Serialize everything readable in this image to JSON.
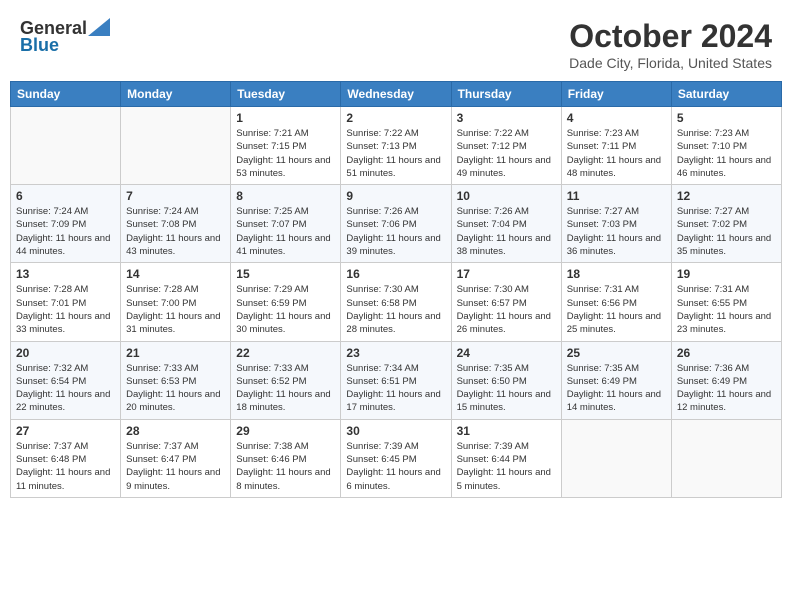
{
  "header": {
    "logo_general": "General",
    "logo_blue": "Blue",
    "month_title": "October 2024",
    "location": "Dade City, Florida, United States"
  },
  "days_of_week": [
    "Sunday",
    "Monday",
    "Tuesday",
    "Wednesday",
    "Thursday",
    "Friday",
    "Saturday"
  ],
  "weeks": [
    [
      {
        "day": "",
        "detail": ""
      },
      {
        "day": "",
        "detail": ""
      },
      {
        "day": "1",
        "detail": "Sunrise: 7:21 AM\nSunset: 7:15 PM\nDaylight: 11 hours and 53 minutes."
      },
      {
        "day": "2",
        "detail": "Sunrise: 7:22 AM\nSunset: 7:13 PM\nDaylight: 11 hours and 51 minutes."
      },
      {
        "day": "3",
        "detail": "Sunrise: 7:22 AM\nSunset: 7:12 PM\nDaylight: 11 hours and 49 minutes."
      },
      {
        "day": "4",
        "detail": "Sunrise: 7:23 AM\nSunset: 7:11 PM\nDaylight: 11 hours and 48 minutes."
      },
      {
        "day": "5",
        "detail": "Sunrise: 7:23 AM\nSunset: 7:10 PM\nDaylight: 11 hours and 46 minutes."
      }
    ],
    [
      {
        "day": "6",
        "detail": "Sunrise: 7:24 AM\nSunset: 7:09 PM\nDaylight: 11 hours and 44 minutes."
      },
      {
        "day": "7",
        "detail": "Sunrise: 7:24 AM\nSunset: 7:08 PM\nDaylight: 11 hours and 43 minutes."
      },
      {
        "day": "8",
        "detail": "Sunrise: 7:25 AM\nSunset: 7:07 PM\nDaylight: 11 hours and 41 minutes."
      },
      {
        "day": "9",
        "detail": "Sunrise: 7:26 AM\nSunset: 7:06 PM\nDaylight: 11 hours and 39 minutes."
      },
      {
        "day": "10",
        "detail": "Sunrise: 7:26 AM\nSunset: 7:04 PM\nDaylight: 11 hours and 38 minutes."
      },
      {
        "day": "11",
        "detail": "Sunrise: 7:27 AM\nSunset: 7:03 PM\nDaylight: 11 hours and 36 minutes."
      },
      {
        "day": "12",
        "detail": "Sunrise: 7:27 AM\nSunset: 7:02 PM\nDaylight: 11 hours and 35 minutes."
      }
    ],
    [
      {
        "day": "13",
        "detail": "Sunrise: 7:28 AM\nSunset: 7:01 PM\nDaylight: 11 hours and 33 minutes."
      },
      {
        "day": "14",
        "detail": "Sunrise: 7:28 AM\nSunset: 7:00 PM\nDaylight: 11 hours and 31 minutes."
      },
      {
        "day": "15",
        "detail": "Sunrise: 7:29 AM\nSunset: 6:59 PM\nDaylight: 11 hours and 30 minutes."
      },
      {
        "day": "16",
        "detail": "Sunrise: 7:30 AM\nSunset: 6:58 PM\nDaylight: 11 hours and 28 minutes."
      },
      {
        "day": "17",
        "detail": "Sunrise: 7:30 AM\nSunset: 6:57 PM\nDaylight: 11 hours and 26 minutes."
      },
      {
        "day": "18",
        "detail": "Sunrise: 7:31 AM\nSunset: 6:56 PM\nDaylight: 11 hours and 25 minutes."
      },
      {
        "day": "19",
        "detail": "Sunrise: 7:31 AM\nSunset: 6:55 PM\nDaylight: 11 hours and 23 minutes."
      }
    ],
    [
      {
        "day": "20",
        "detail": "Sunrise: 7:32 AM\nSunset: 6:54 PM\nDaylight: 11 hours and 22 minutes."
      },
      {
        "day": "21",
        "detail": "Sunrise: 7:33 AM\nSunset: 6:53 PM\nDaylight: 11 hours and 20 minutes."
      },
      {
        "day": "22",
        "detail": "Sunrise: 7:33 AM\nSunset: 6:52 PM\nDaylight: 11 hours and 18 minutes."
      },
      {
        "day": "23",
        "detail": "Sunrise: 7:34 AM\nSunset: 6:51 PM\nDaylight: 11 hours and 17 minutes."
      },
      {
        "day": "24",
        "detail": "Sunrise: 7:35 AM\nSunset: 6:50 PM\nDaylight: 11 hours and 15 minutes."
      },
      {
        "day": "25",
        "detail": "Sunrise: 7:35 AM\nSunset: 6:49 PM\nDaylight: 11 hours and 14 minutes."
      },
      {
        "day": "26",
        "detail": "Sunrise: 7:36 AM\nSunset: 6:49 PM\nDaylight: 11 hours and 12 minutes."
      }
    ],
    [
      {
        "day": "27",
        "detail": "Sunrise: 7:37 AM\nSunset: 6:48 PM\nDaylight: 11 hours and 11 minutes."
      },
      {
        "day": "28",
        "detail": "Sunrise: 7:37 AM\nSunset: 6:47 PM\nDaylight: 11 hours and 9 minutes."
      },
      {
        "day": "29",
        "detail": "Sunrise: 7:38 AM\nSunset: 6:46 PM\nDaylight: 11 hours and 8 minutes."
      },
      {
        "day": "30",
        "detail": "Sunrise: 7:39 AM\nSunset: 6:45 PM\nDaylight: 11 hours and 6 minutes."
      },
      {
        "day": "31",
        "detail": "Sunrise: 7:39 AM\nSunset: 6:44 PM\nDaylight: 11 hours and 5 minutes."
      },
      {
        "day": "",
        "detail": ""
      },
      {
        "day": "",
        "detail": ""
      }
    ]
  ]
}
